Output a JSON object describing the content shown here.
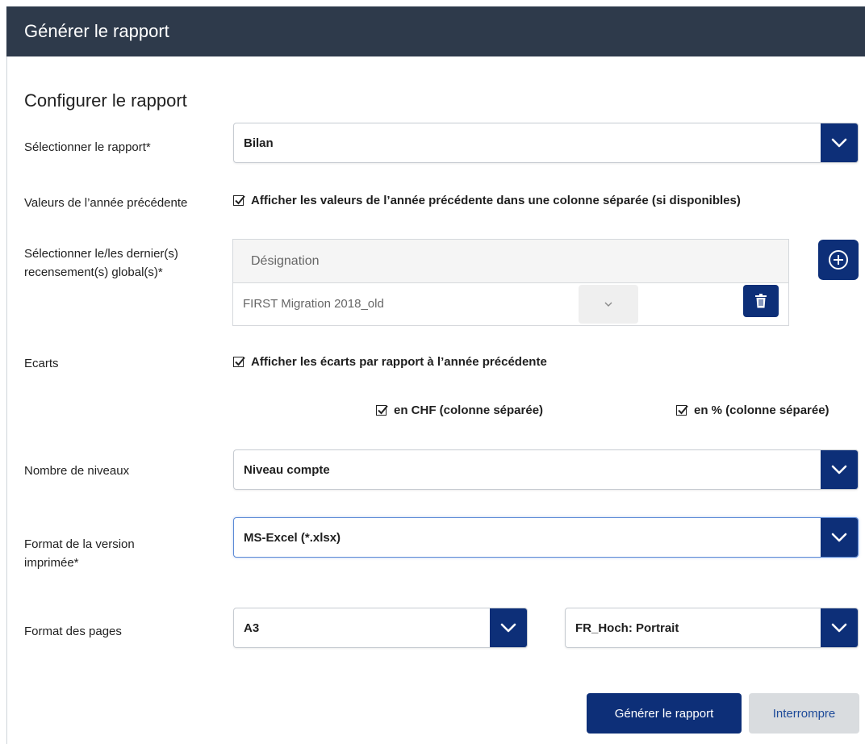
{
  "dialog": {
    "title": "Générer le rapport"
  },
  "section_title": "Configurer le rapport",
  "report_select": {
    "label": "Sélectionner le rapport*",
    "value": "Bilan"
  },
  "prev_year": {
    "label": "Valeurs de l’année précédente",
    "checkbox_label": "Afficher les valeurs de l’année précédente dans une colonne séparée (si disponibles)",
    "checked": true
  },
  "census": {
    "label_line1": "Sélectionner le/les dernier(s)",
    "label_line2": "recensement(s) global(s)*",
    "column_header": "Désignation",
    "rows": [
      {
        "name": "FIRST Migration 2018_old"
      }
    ]
  },
  "deviations": {
    "label": "Ecarts",
    "checkbox_label": "Afficher les écarts par rapport à l’année précédente",
    "checked": true,
    "chf_label": "en CHF (colonne séparée)",
    "chf_checked": true,
    "pct_label": "en % (colonne séparée)",
    "pct_checked": true
  },
  "levels": {
    "label": "Nombre de niveaux",
    "value": "Niveau compte"
  },
  "print_format": {
    "label_line1": "Format de la version",
    "label_line2": "imprimée*",
    "value": "MS-Excel (*.xlsx)"
  },
  "page_format": {
    "label": "Format des pages",
    "size_value": "A3",
    "orientation_value": "FR_Hoch: Portrait"
  },
  "buttons": {
    "generate": "Générer le rapport",
    "cancel": "Interrompre"
  },
  "colors": {
    "header_bg": "#2e3a4b",
    "accent": "#0d2f78",
    "secondary_bg": "#d9dcdf",
    "secondary_text": "#1d4a99"
  },
  "icons": {
    "dropdown": "chevron-down-icon",
    "add": "plus-circle-icon",
    "delete": "trash-icon",
    "check": "checkmark-icon"
  }
}
